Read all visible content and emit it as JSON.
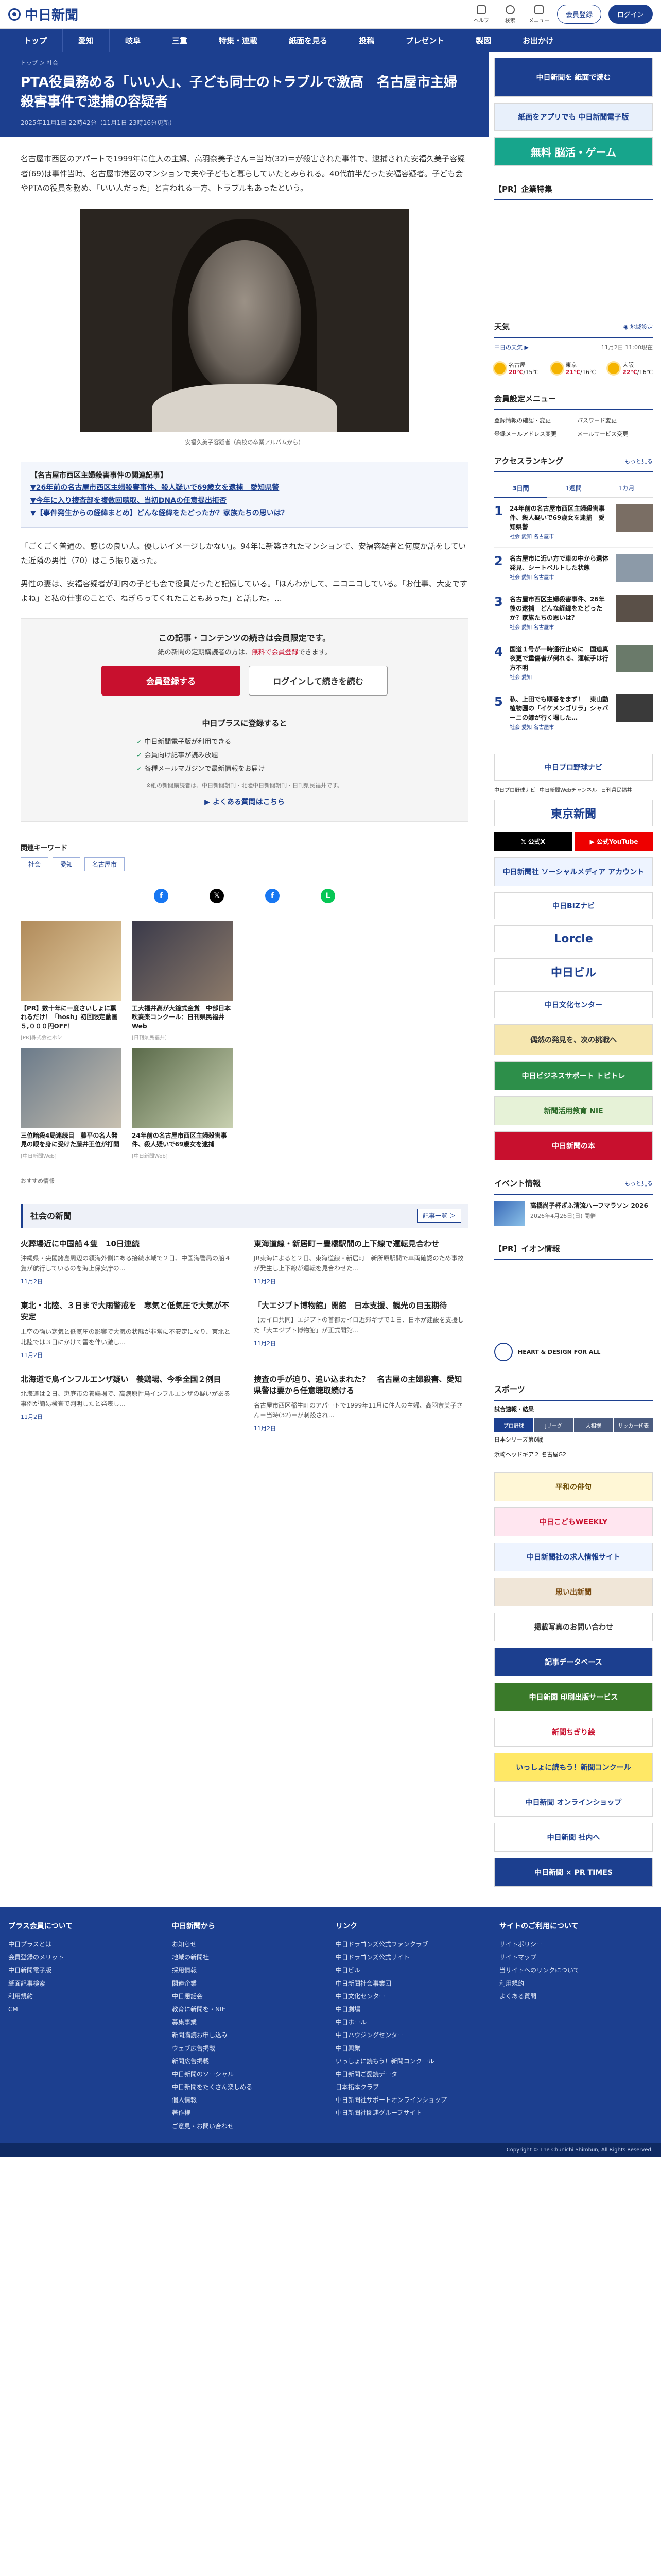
{
  "site": {
    "logo": "中日新聞"
  },
  "header": {
    "icons": [
      {
        "label": "ヘルプ",
        "icon": "help-icon"
      },
      {
        "label": "検索",
        "icon": "search-icon"
      },
      {
        "label": "メニュー",
        "icon": "menu-icon"
      }
    ],
    "register_label": "会員登録",
    "login_label": "ログイン"
  },
  "nav": [
    "トップ",
    "愛知",
    "岐阜",
    "三重",
    "特集・連載",
    "紙面を見る",
    "投稿",
    "プレゼント",
    "製図",
    "お出かけ"
  ],
  "article": {
    "breadcrumb": "トップ ＞ 社会",
    "title": "PTA役員務める「いい人」、子ども同士のトラブルで激高　名古屋市主婦殺害事件で逮捕の容疑者",
    "date": "2025年11月1日 22時42分（11月1日 23時16分更新）",
    "lead": "名古屋市西区のアパートで1999年に住人の主婦、高羽奈美子さん＝当時(32)＝が殺害された事件で、逮捕された安福久美子容疑者(69)は事件当時、名古屋市港区のマンションで夫や子どもと暮らしていたとみられる。40代前半だった安福容疑者。子ども会やPTAの役員を務め、「いい人だった」と言われる一方、トラブルもあったという。",
    "caption": "安福久美子容疑者（高校の卒業アルバムから）",
    "related_title": "【名古屋市西区主婦殺害事件の関連記事】",
    "related_links": [
      "▼26年前の名古屋市西区主婦殺害事件、殺人疑いで69歳女を逮捕　愛知県警",
      "▼今年に入り捜査部を複数回聴取、当初DNAの任意提出拒否",
      "▼【事件発生からの経緯まとめ】どんな経緯をたどったか？家族たちの思いは？"
    ],
    "body": [
      "「ごくごく普通の、感じの良い人。優しいイメージしかない」。94年に新築されたマンションで、安福容疑者と何度か話をしていた近隣の男性（70）はこう振り返った。",
      "男性の妻は、安福容疑者が町内の子ども会で役員だったと記憶している。「ほんわかして、ニコニコしている。「お仕事、大変ですよね」と私の仕事のことで、ねぎらってくれたこともあった」と話した。…"
    ]
  },
  "paywall": {
    "title": "この記事・コンテンツの続きは会員限定です。",
    "sub_pre": "紙の新聞の定期購読者の方は、",
    "sub_red": "無料で会員登録",
    "sub_post": "できます。",
    "register_btn": "会員登録する",
    "login_btn": "ログインして続きを読む",
    "plus_title": "中日プラスに登録すると",
    "benefits": [
      "中日新聞電子版が利用できる",
      "会員向け記事が読み放題",
      "各種メールマガジンで最新情報をお届け"
    ],
    "note": "※紙の新聞購読者は、中日新聞朝刊・北陸中日新聞朝刊・日刊県民福井です。",
    "more": "▶ よくある質問はこちら"
  },
  "keywords": {
    "title": "関連キーワード",
    "items": [
      "社会",
      "愛知",
      "名古屋市"
    ]
  },
  "recommended": {
    "items": [
      {
        "title": "【PR】数十年に一度さいしょに薫れるだけ！「hosh」初回限定動画５,０００円OFF！",
        "source": "[PR]株式会社ホシ"
      },
      {
        "title": "工大福井高が大鐘式金賞　中部日本吹奏楽コンクール：日刊県民福井Web",
        "source": "[日刊県民福井]"
      },
      {
        "title": "三位暗殺4局連続目　藤平の名人発見の眼を身に受けた藤井王位が打開",
        "source": "[中日新聞Web]"
      },
      {
        "title": "24年前の名古屋市西区主婦殺害事件、殺人疑いで69歳女を逮捕",
        "source": "[中日新聞Web]"
      }
    ],
    "tag": "おすすめ情報"
  },
  "society": {
    "title": "社会の新聞",
    "more": "記事一覧 ＞",
    "items": [
      {
        "title": "火葬場近に中国船４隻　10日連続",
        "desc": "沖縄県・尖閣諸島周辺の領海外側にある接続水域で２日、中国海警局の船４隻が航行しているのを海上保安庁の…",
        "date": "11月2日"
      },
      {
        "title": "東海道線・新居町－豊橋駅間の上下線で運転見合わせ",
        "desc": "JR東海によると２日、東海道線・新居町－新所原駅間で車両確認のため事故が発生し上下線が運転を見合わせた…",
        "date": "11月2日"
      },
      {
        "title": "東北・北陸、３日まで大雨警戒を　寒気と低気圧で大気が不安定",
        "desc": "上空の強い寒気と低気圧の影響で大気の状態が非常に不安定になり、東北と北陸では３日にかけて雷を伴い激し…",
        "date": "11月2日"
      },
      {
        "title": "「大エジプト博物館」開館　日本支援、観光の目玉期待",
        "desc": "【カイロ共同】エジプトの首都カイロ近郊ギザで１日、日本が建設を支援した「大エジプト博物館」が正式開館…",
        "date": "11月2日"
      },
      {
        "title": "北海道で鳥インフルエンザ疑い　養鶏場、今季全国２例目",
        "desc": "北海道は２日、恵庭市の養鶏場で、高病原性鳥インフルエンザの疑いがある事例が簡易検査で判明したと発表し…",
        "date": "11月2日"
      },
      {
        "title": "捜査の手が迫り、追い込まれた？　名古屋の主婦殺害、愛知県警は要から任意聴取続ける",
        "desc": "名古屋市西区稲生町のアパートで1999年11月に住人の主婦、高羽奈美子さん＝当時(32)＝が刺殺され…",
        "date": "11月2日"
      }
    ]
  },
  "sidebar": {
    "top_ads": [
      "中日新聞を 紙面で読む",
      "紙面をアプリでも 中日新聞電子版",
      "無料 脳活・ゲーム"
    ],
    "pr_company": "【PR】企業特集",
    "weather": {
      "title": "天気",
      "more": "◉ 地域設定",
      "region": "中日の天気 ▶",
      "updated": "11月2日 11:00現在",
      "cities": [
        {
          "name": "名古屋",
          "hi": "20℃",
          "lo": "15℃"
        },
        {
          "name": "東京",
          "hi": "21℃",
          "lo": "16℃"
        },
        {
          "name": "大阪",
          "hi": "22℃",
          "lo": "16℃"
        }
      ]
    },
    "member_menu": {
      "title": "会員設定メニュー",
      "items": [
        "登録情報の確認・変更",
        "パスワード変更",
        "登録メールアドレス変更",
        "メールサービス変更"
      ]
    },
    "ranking": {
      "title": "アクセスランキング",
      "more": "もっと見る",
      "tabs": [
        "3日間",
        "1週間",
        "1カ月"
      ],
      "items": [
        {
          "num": "1",
          "title": "24年前の名古屋市西区主婦殺害事件、殺人疑いで69歳女を逮捕　愛知県警",
          "tag": "社会 愛知 名古屋市"
        },
        {
          "num": "2",
          "title": "名古屋市に近い方で車の中から遺体発見、シートベルトした状態",
          "tag": "社会 愛知 名古屋市"
        },
        {
          "num": "3",
          "title": "名古屋市西区主婦殺害事件、26年後の逮捕　どんな経緯をたどったか？家族たちの思いは？",
          "tag": "社会 愛知 名古屋市"
        },
        {
          "num": "4",
          "title": "国道１号が一時通行止めに　国道真夜更で重傷者が倒れる、運転手は行方不明",
          "tag": "社会 愛知"
        },
        {
          "num": "5",
          "title": "私、上田でも順番をまず！　東山動植物園の「イケメンゴリラ」シャバーニの嫁が行く場した…",
          "tag": "社会 愛知 名古屋市"
        }
      ]
    },
    "sponsors": [
      "中日プロ野球ナビ",
      "中日新聞Webチャンネル",
      "日刊県民福井"
    ],
    "tokyo": "東京新聞",
    "x_label": "𝕏 公式X",
    "yt_label": "▶ 公式YouTube",
    "banners": [
      "中日新聞社 ソーシャルメディア アカウント",
      "中日BIZナビ",
      "Lorcle",
      "中日ビル",
      "中日文化センター",
      "偶然の発見を、次の挑戦へ",
      "中日ビジネスサポート トビトレ",
      "新聞活用教育 NIE",
      "中日新聞の本"
    ],
    "events": {
      "title": "イベント情報",
      "more": "もっと見る",
      "item_title": "高橋尚子杯ぎふ清流ハーフマラソン 2026",
      "item_date": "2026年4月26日(日) 開催"
    },
    "pr_ion": "【PR】イオン情報",
    "heart": "HEART & DESIGN FOR ALL",
    "sports": {
      "title": "スポーツ",
      "sub": "試合速報・結果",
      "tabs": [
        "プロ野球",
        "Jリーグ",
        "大相撲",
        "サッカー代表"
      ],
      "score_line": "浜崎ヘッドギア２ 名古屋G2",
      "score_line2": "日本シリーズ第6戦"
    },
    "side_banners": [
      "平和の俳句",
      "中日こどもWEEKLY",
      "中日新聞社の求人情報サイト",
      "思い出新聞",
      "掲載写真のお問い合わせ",
      "記事データベース",
      "中日新聞 印刷出版サービス",
      "新聞ちぎり絵",
      "いっしょに読もう！新聞コンクール",
      "中日新聞 オンラインショップ",
      "中日新聞 社内へ",
      "中日新聞 × PR TIMES"
    ]
  },
  "footer": {
    "cols": [
      {
        "title": "プラス会員について",
        "links": [
          "中日プラスとは",
          "会員登録のメリット",
          "中日新聞電子版",
          "紙面記事検索",
          "利用規約",
          "CM"
        ]
      },
      {
        "title": "中日新聞から",
        "links": [
          "お知らせ",
          "地域の新聞社",
          "採用情報",
          "関連企業",
          "中日懇話会",
          "教育に新聞を・NIE",
          "募集事業",
          "新聞購読お申し込み",
          "ウェブ広告掲載",
          "新聞広告掲載",
          "中日新聞のソーシャル",
          "中日新聞をたくさん楽しめる",
          "個人情報",
          "著作権",
          "ご意見・お問い合わせ"
        ]
      },
      {
        "title": "リンク",
        "links": [
          "中日ドラゴンズ公式ファンクラブ",
          "中日ドラゴンズ公式サイト",
          "中日ビル",
          "中日新聞社会事業団",
          "中日文化センター",
          "中日劇場",
          "中日ホール",
          "中日ハウジングセンター",
          "中日興業",
          "いっしょに読もう！新聞コンクール",
          "中日新聞ご愛読データ",
          "日本拓本クラブ",
          "中日新聞社サポートオンラインショップ",
          "中日新聞社関連グループサイト"
        ]
      },
      {
        "title": "サイトのご利用について",
        "links": [
          "サイトポリシー",
          "サイトマップ",
          "当サイトへのリンクについて",
          "利用規約",
          "よくある質問"
        ]
      }
    ],
    "copyright": "Copyright © The Chunichi Shimbun, All Rights Reserved."
  }
}
